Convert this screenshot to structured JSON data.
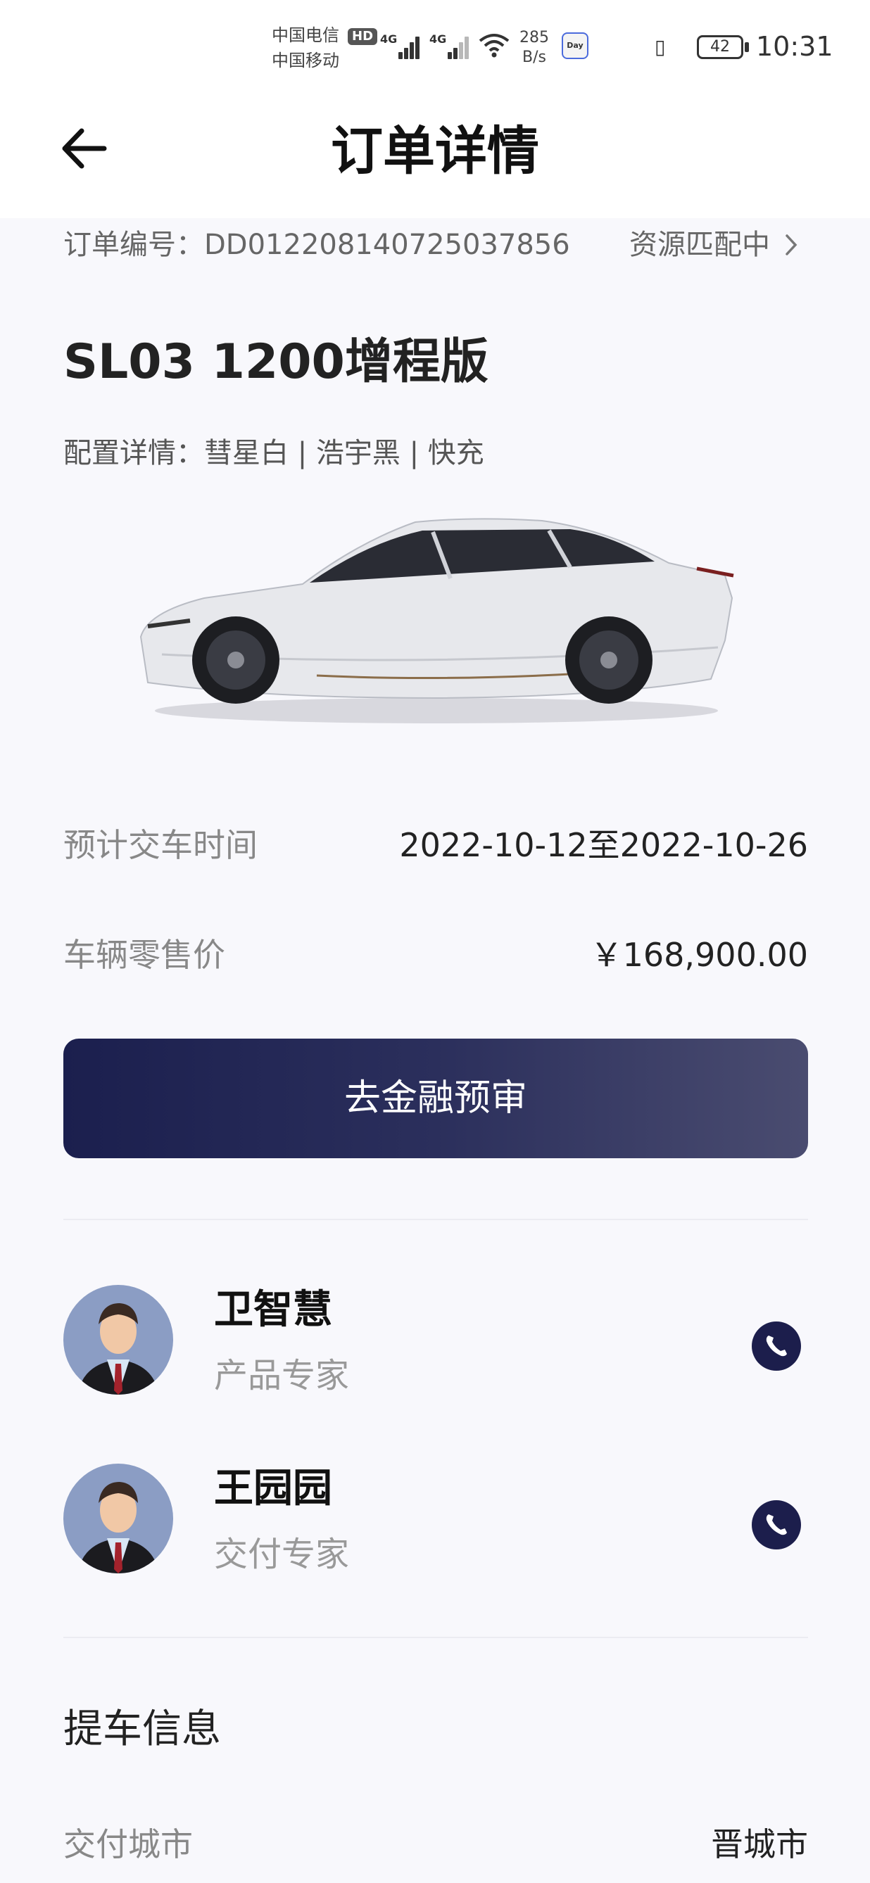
{
  "status_bar": {
    "carrier1": "中国电信",
    "carrier2": "中国移动",
    "hd_badge": "HD",
    "signal1_label": "4G",
    "signal2_label": "4G",
    "net_speed_value": "285",
    "net_speed_unit": "B/s",
    "app_badge": "Day",
    "battery": "42",
    "time": "10:31"
  },
  "header": {
    "title": "订单详情"
  },
  "order": {
    "number": "订单编号：DD012208140725037856",
    "status": "资源匹配中",
    "model": "SL03 1200增程版",
    "config": "配置详情：彗星白 | 浩宇黑 | 快充"
  },
  "details": {
    "delivery_label": "预计交车时间",
    "delivery_value": "2022-10-12至2022-10-26",
    "price_label": "车辆零售价",
    "price_value": "￥168,900.00"
  },
  "actions": {
    "finance_button": "去金融预审"
  },
  "contacts": [
    {
      "name": "卫智慧",
      "role": "产品专家"
    },
    {
      "name": "王园园",
      "role": "交付专家"
    }
  ],
  "pickup": {
    "section_title": "提车信息",
    "city_label": "交付城市",
    "city_value": "晋城市"
  }
}
